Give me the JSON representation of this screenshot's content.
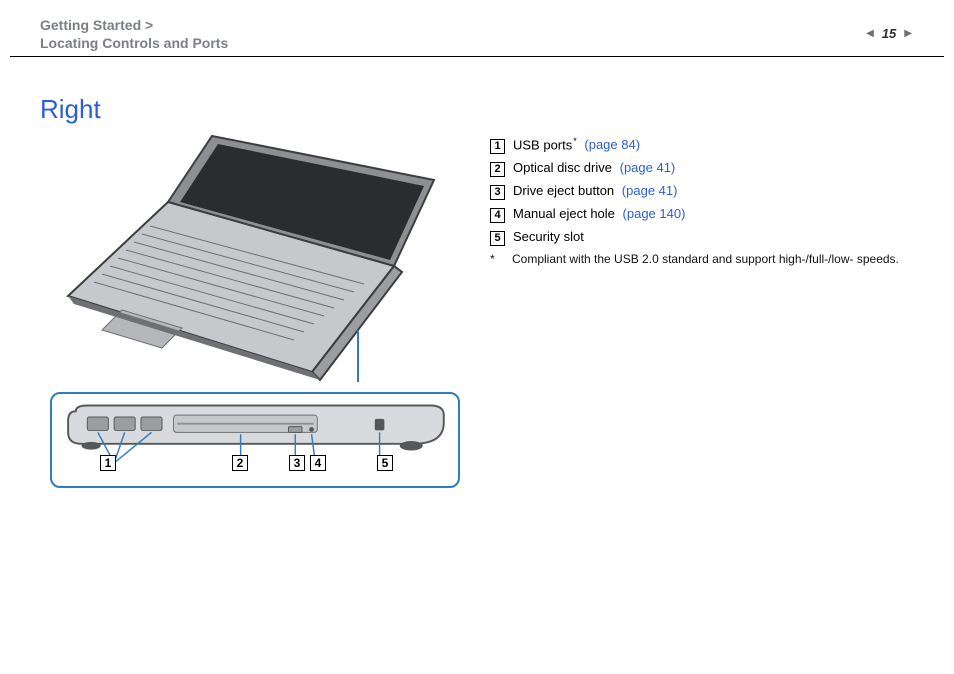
{
  "header": {
    "breadcrumb_line1": "Getting Started >",
    "breadcrumb_line2": "Locating Controls and Ports",
    "page_number": "15",
    "arrow_left": "◀",
    "arrow_right": "▶"
  },
  "title": "Right",
  "figure": {
    "callout_numbers": [
      "1",
      "2",
      "3",
      "4",
      "5"
    ]
  },
  "legend": {
    "items": [
      {
        "num": "1",
        "label": "USB ports",
        "sup": "*",
        "page_ref": "(page 84)"
      },
      {
        "num": "2",
        "label": "Optical disc drive",
        "sup": "",
        "page_ref": "(page 41)"
      },
      {
        "num": "3",
        "label": "Drive eject button",
        "sup": "",
        "page_ref": "(page 41)"
      },
      {
        "num": "4",
        "label": "Manual eject hole",
        "sup": "",
        "page_ref": "(page 140)"
      },
      {
        "num": "5",
        "label": "Security slot",
        "sup": "",
        "page_ref": ""
      }
    ],
    "footnote_mark": "*",
    "footnote_text": "Compliant with the USB 2.0 standard and support high-/full-/low- speeds."
  }
}
